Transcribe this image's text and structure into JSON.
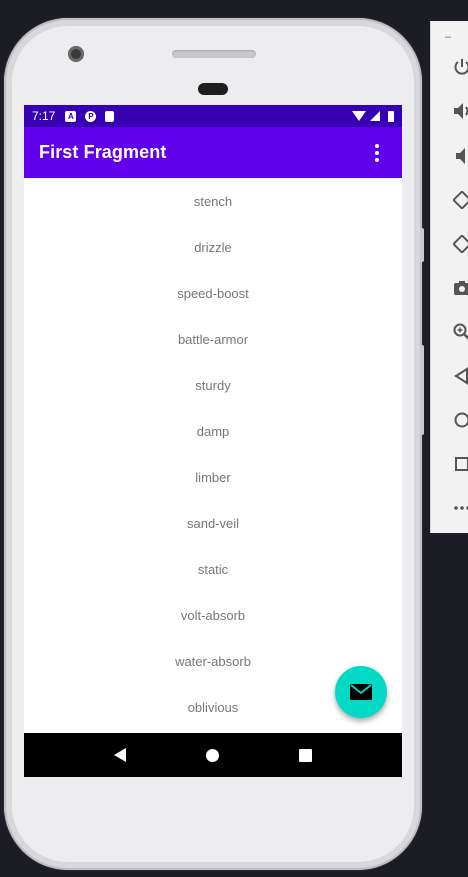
{
  "status_bar": {
    "time": "7:17",
    "icons": [
      "a-notification-icon",
      "p-notification-icon",
      "sd-card-icon"
    ],
    "right_icons": [
      "wifi-icon",
      "signal-icon",
      "battery-icon"
    ]
  },
  "app_bar": {
    "title": "First Fragment",
    "overflow_icon": "more-vert-icon"
  },
  "list": {
    "items": [
      "stench",
      "drizzle",
      "speed-boost",
      "battle-armor",
      "sturdy",
      "damp",
      "limber",
      "sand-veil",
      "static",
      "volt-absorb",
      "water-absorb",
      "oblivious"
    ]
  },
  "fab": {
    "icon": "email-icon"
  },
  "nav_bar": {
    "buttons": [
      "back-icon",
      "home-icon",
      "recents-icon"
    ]
  },
  "emulator_toolbar": {
    "dash": "–",
    "buttons": [
      "power-icon",
      "volume-up-icon",
      "volume-down-icon",
      "rotate-left-icon",
      "rotate-right-icon",
      "camera-icon",
      "zoom-icon",
      "back-icon",
      "home-icon",
      "overview-icon",
      "more-icon"
    ]
  },
  "colors": {
    "primary": "#6200ee",
    "primary_dark": "#3700b3",
    "accent": "#03dac5",
    "list_text": "#777777"
  }
}
